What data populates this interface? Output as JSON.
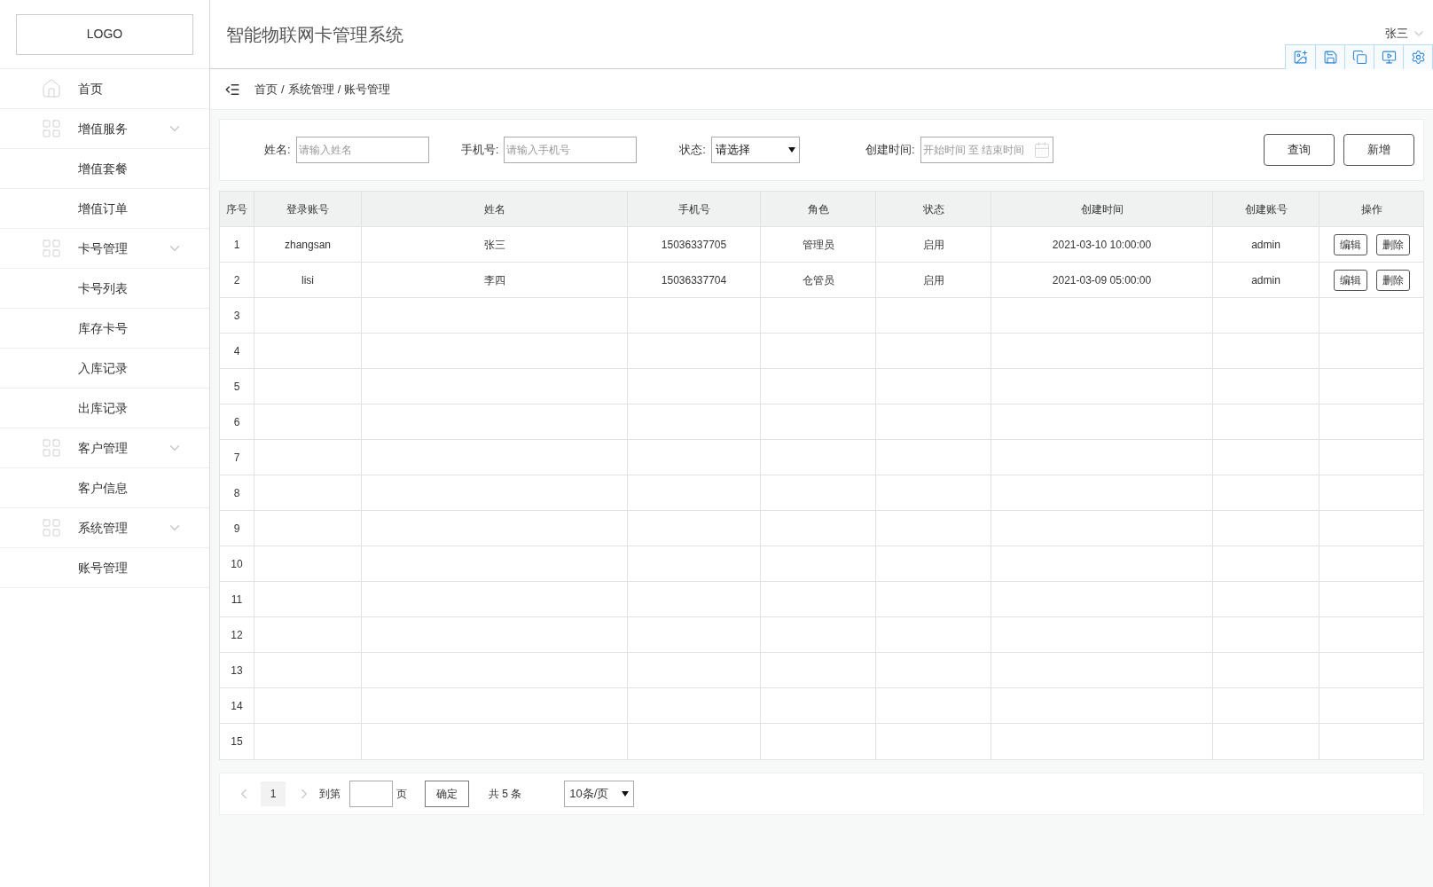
{
  "sidebar": {
    "logo": "LOGO",
    "items": [
      {
        "kind": "home",
        "label": "首页"
      },
      {
        "kind": "group",
        "label": "增值服务",
        "expanded": true,
        "children": [
          {
            "label": "增值套餐"
          },
          {
            "label": "增值订单"
          }
        ]
      },
      {
        "kind": "group",
        "label": "卡号管理",
        "expanded": true,
        "children": [
          {
            "label": "卡号列表"
          },
          {
            "label": "库存卡号"
          },
          {
            "label": "入库记录"
          },
          {
            "label": "出库记录"
          }
        ]
      },
      {
        "kind": "group",
        "label": "客户管理",
        "expanded": true,
        "children": [
          {
            "label": "客户信息"
          }
        ]
      },
      {
        "kind": "group",
        "label": "系统管理",
        "expanded": true,
        "children": [
          {
            "label": "账号管理"
          }
        ]
      }
    ]
  },
  "header": {
    "title": "智能物联网卡管理系统",
    "user": "张三"
  },
  "breadcrumb": [
    "首页",
    "系统管理",
    "账号管理"
  ],
  "breadcrumb_separator": "/",
  "filters": {
    "fields": [
      {
        "kind": "text",
        "label": "姓名:",
        "placeholder": "请输入姓名"
      },
      {
        "kind": "text",
        "label": "手机号:",
        "placeholder": "请输入手机号"
      },
      {
        "kind": "select",
        "label": "状态:",
        "value": "请选择"
      },
      {
        "kind": "daterange",
        "label": "创建时间:",
        "placeholder": "开始时间 至 结束时间"
      }
    ],
    "buttons": [
      "查询",
      "新增"
    ]
  },
  "table": {
    "columns": [
      "序号",
      "登录账号",
      "姓名",
      "手机号",
      "角色",
      "状态",
      "创建时间",
      "创建账号",
      "操作"
    ],
    "rows": [
      {
        "index": "1",
        "cells": [
          "zhangsan",
          "张三",
          "15036337705",
          "管理员",
          "启用",
          "2021-03-10 10:00:00",
          "admin"
        ],
        "actions": [
          "编辑",
          "删除"
        ]
      },
      {
        "index": "2",
        "cells": [
          "lisi",
          "李四",
          "15036337704",
          "仓管员",
          "启用",
          "2021-03-09 05:00:00",
          "admin"
        ],
        "actions": [
          "编辑",
          "删除"
        ]
      },
      {
        "index": "3"
      },
      {
        "index": "4"
      },
      {
        "index": "5"
      },
      {
        "index": "6"
      },
      {
        "index": "7"
      },
      {
        "index": "8"
      },
      {
        "index": "9"
      },
      {
        "index": "10"
      },
      {
        "index": "11"
      },
      {
        "index": "12"
      },
      {
        "index": "13"
      },
      {
        "index": "14"
      },
      {
        "index": "15"
      }
    ]
  },
  "pagination": {
    "pages": [
      {
        "label": "1",
        "selected": true
      }
    ],
    "goto_label": "到第",
    "page_suffix": "页",
    "confirm": "确定",
    "total": "共 5 条",
    "page_size": "10条/页"
  }
}
